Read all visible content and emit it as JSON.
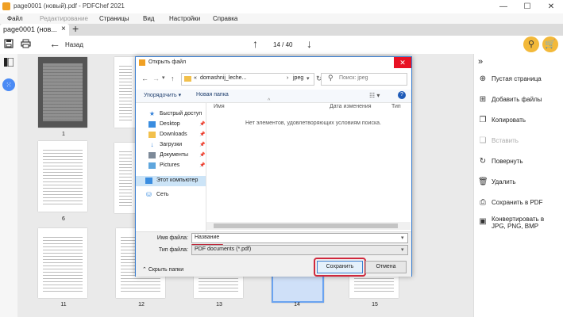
{
  "window": {
    "title": "page0001 (новый).pdf - PDFChef 2021",
    "minimize": "—",
    "maximize": "☐",
    "close": "✕"
  },
  "menu": [
    "Файл",
    "Редактирование",
    "Страницы",
    "Вид",
    "Настройки",
    "Справка"
  ],
  "tabs": [
    {
      "label": "page0001 (нов...",
      "close": "×"
    }
  ],
  "tab_add": "+",
  "toolbar": {
    "back_label": "Назад",
    "page_indicator": "14 / 40",
    "save_icon": "save-icon",
    "print_icon": "print-icon"
  },
  "thumbnails": [
    {
      "label": "1"
    },
    {
      "label": ""
    },
    {
      "label": "6"
    },
    {
      "label": ""
    },
    {
      "label": "11"
    },
    {
      "label": "12"
    },
    {
      "label": "13"
    },
    {
      "label": "14"
    },
    {
      "label": "15"
    }
  ],
  "right_panel": {
    "items": [
      {
        "label": "Пустая страница",
        "icon": "blank-page-icon",
        "enabled": true
      },
      {
        "label": "Добавить файлы",
        "icon": "add-files-icon",
        "enabled": true
      },
      {
        "label": "Копировать",
        "icon": "copy-icon",
        "enabled": true
      },
      {
        "label": "Вставить",
        "icon": "paste-icon",
        "enabled": false
      },
      {
        "label": "Повернуть",
        "icon": "rotate-icon",
        "enabled": true
      },
      {
        "label": "Удалить",
        "icon": "delete-icon",
        "enabled": true
      },
      {
        "label": "Сохранить в PDF",
        "icon": "save-pdf-icon",
        "enabled": true
      },
      {
        "label": "Конвертировать в JPG, PNG, BMP",
        "icon": "convert-icon",
        "enabled": true
      }
    ]
  },
  "dialog": {
    "title": "Открыть файл",
    "address": {
      "prefix": "«",
      "folder": "domashnij_leche...",
      "subfolder": "jpeg"
    },
    "search_placeholder": "Поиск: jpeg",
    "organize": "Упорядочить ▾",
    "new_folder": "Новая папка",
    "columns": [
      "Имя",
      "Дата изменения",
      "Тип"
    ],
    "empty_message": "Нет элементов, удовлетворяющих условиям поиска.",
    "nav": [
      {
        "label": "Быстрый доступ",
        "icon": "star-icon",
        "color": "#2f7ed8"
      },
      {
        "label": "Desktop",
        "icon": "desktop-icon",
        "color": "#3a8de0"
      },
      {
        "label": "Downloads",
        "icon": "folder-icon",
        "color": "#f2c04c"
      },
      {
        "label": "Загрузки",
        "icon": "download-icon",
        "color": "#2f7ed8"
      },
      {
        "label": "Документы",
        "icon": "documents-icon",
        "color": "#7d8a99"
      },
      {
        "label": "Pictures",
        "icon": "pictures-icon",
        "color": "#5fa6dd"
      },
      {
        "label": "Этот компьютер",
        "icon": "computer-icon",
        "color": "#3a8de0"
      },
      {
        "label": "Сеть",
        "icon": "network-icon",
        "color": "#3a8de0"
      }
    ],
    "file_name_label": "Имя файла:",
    "file_name_value": "Название",
    "file_type_label": "Тип файла:",
    "file_type_value": "PDF documents (*.pdf)",
    "hide_folders": "Скрыть папки",
    "save_button": "Сохранить",
    "cancel_button": "Отмена"
  },
  "colors": {
    "accent": "#f3b93a",
    "highlight_ring": "#d0283c",
    "selection": "#6aa3f0"
  }
}
